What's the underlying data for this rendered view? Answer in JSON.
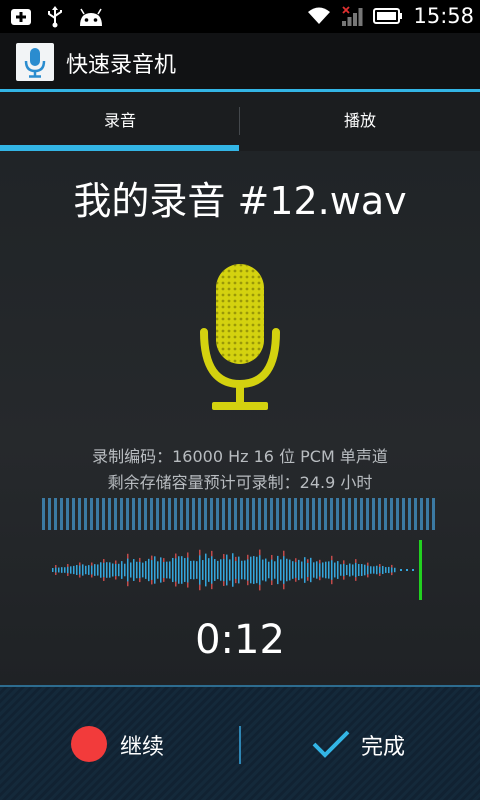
{
  "status_bar": {
    "time": "15:58"
  },
  "app": {
    "title": "快速录音机"
  },
  "tabs": [
    {
      "label": "录音"
    },
    {
      "label": "播放"
    }
  ],
  "recording": {
    "filename": "我的录音 #12.wav",
    "encoding_info": "录制编码：16000 Hz 16 位 PCM 单声道",
    "storage_info": "剩余存储容量预计可录制：24.9 小时",
    "elapsed": "0:12"
  },
  "actions": {
    "resume_label": "继续",
    "done_label": "完成"
  },
  "colors": {
    "accent": "#33b5e5",
    "mic": "#d4d20f",
    "record": "#f23b3b",
    "cursor": "#22d020",
    "wave_blue": "#35a6dc",
    "wave_red": "#c24a4a"
  }
}
